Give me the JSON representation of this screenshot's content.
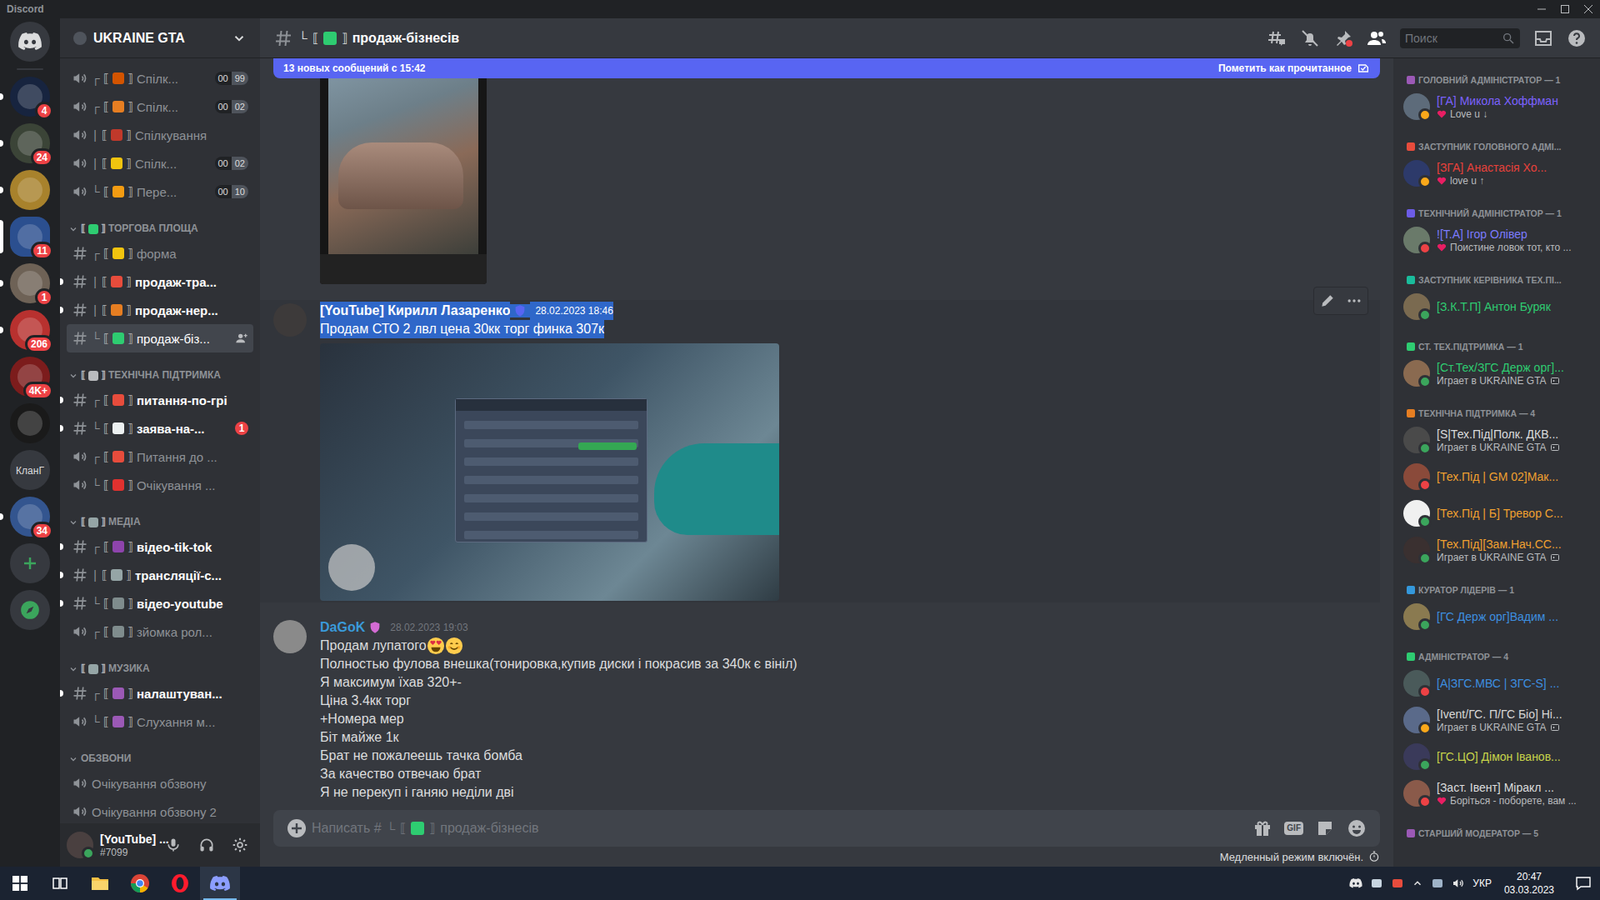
{
  "window": {
    "title": "Discord"
  },
  "servers": [
    {
      "kind": "home",
      "color": "#36393f",
      "badge": "",
      "unread": false,
      "selected": false
    },
    {
      "kind": "server",
      "color": "#17243f",
      "badge": "4",
      "unread": true,
      "selected": false
    },
    {
      "kind": "server",
      "color": "#3b4437",
      "badge": "24",
      "unread": true,
      "selected": false
    },
    {
      "kind": "server",
      "color": "#a8822c",
      "badge": "",
      "unread": true,
      "selected": false
    },
    {
      "kind": "server",
      "color": "#2b4f8f",
      "badge": "11",
      "unread": false,
      "selected": true
    },
    {
      "kind": "server",
      "color": "#6e6256",
      "badge": "1",
      "unread": true,
      "selected": false
    },
    {
      "kind": "server",
      "color": "#b8312f",
      "badge": "206",
      "unread": true,
      "selected": false
    },
    {
      "kind": "server",
      "color": "#7c1c1c",
      "badge": "4K+",
      "unread": false,
      "selected": false
    },
    {
      "kind": "server",
      "color": "#1a1a1a",
      "badge": "",
      "unread": false,
      "selected": false
    },
    {
      "kind": "text",
      "label": "КланГ",
      "color": "#36393f",
      "badge": "",
      "unread": false,
      "selected": false
    },
    {
      "kind": "server",
      "color": "#33558f",
      "badge": "34",
      "unread": true,
      "selected": false
    },
    {
      "kind": "add",
      "color": "#36393f",
      "badge": "",
      "unread": false,
      "selected": false
    },
    {
      "kind": "explore",
      "color": "#36393f",
      "badge": "",
      "unread": false,
      "selected": false
    }
  ],
  "sidebar": {
    "server_name": "UKRAINE GTA",
    "bracket_open": "⟦",
    "bracket_close": "⟧",
    "groups": [
      {
        "category": null,
        "channels": [
          {
            "kind": "voice",
            "tree": "┌",
            "emoji_color": "#d35400",
            "name": "Спілк...",
            "counts": [
              "00",
              "99"
            ],
            "unread": false,
            "selected": false,
            "badge": "",
            "invite": false
          },
          {
            "kind": "voice",
            "tree": "┌",
            "emoji_color": "#e67e22",
            "name": "Спілк...",
            "counts": [
              "00",
              "02"
            ],
            "unread": false,
            "selected": false,
            "badge": "",
            "invite": false
          },
          {
            "kind": "voice",
            "tree": "|",
            "emoji_color": "#c0392b",
            "name": "Спілкування",
            "counts": [],
            "unread": false,
            "selected": false,
            "badge": "",
            "invite": false
          },
          {
            "kind": "voice",
            "tree": "|",
            "emoji_color": "#f1c40f",
            "name": "Спілк...",
            "counts": [
              "00",
              "02"
            ],
            "unread": false,
            "selected": false,
            "badge": "",
            "invite": false
          },
          {
            "kind": "voice",
            "tree": "└",
            "emoji_color": "#f39c12",
            "name": "Пере...",
            "counts": [
              "00",
              "10"
            ],
            "unread": false,
            "selected": false,
            "badge": "",
            "invite": false
          }
        ]
      },
      {
        "category": {
          "label": "ТОРГОВА ПЛОЩА",
          "emoji_color": "#2ecc71",
          "expanded": true
        },
        "channels": [
          {
            "kind": "text",
            "tree": "┌",
            "emoji_color": "#f1c40f",
            "name": "форма",
            "counts": [],
            "unread": false,
            "selected": false,
            "badge": "",
            "invite": false
          },
          {
            "kind": "text",
            "tree": "|",
            "emoji_color": "#e74c3c",
            "name": "продаж-тра...",
            "counts": [],
            "unread": true,
            "selected": false,
            "badge": "",
            "invite": false
          },
          {
            "kind": "text",
            "tree": "|",
            "emoji_color": "#e67e22",
            "name": "продаж-нер...",
            "counts": [],
            "unread": true,
            "selected": false,
            "badge": "",
            "invite": false
          },
          {
            "kind": "text",
            "tree": "└",
            "emoji_color": "#2ecc71",
            "name": "продаж-біз...",
            "counts": [],
            "unread": false,
            "selected": true,
            "badge": "",
            "invite": true
          }
        ]
      },
      {
        "category": {
          "label": "ТЕХНІЧНА ПІДТРИМКА",
          "emoji_color": "#b9bbbe",
          "expanded": true
        },
        "channels": [
          {
            "kind": "text",
            "tree": "┌",
            "emoji_color": "#e74c3c",
            "name": "питання-по-грі",
            "counts": [],
            "unread": true,
            "selected": false,
            "badge": "",
            "invite": false
          },
          {
            "kind": "text",
            "tree": "└",
            "emoji_color": "#ecf0f1",
            "name": "заява-на-...",
            "counts": [],
            "unread": true,
            "selected": false,
            "badge": "1",
            "invite": false
          },
          {
            "kind": "voice",
            "tree": "┌",
            "emoji_color": "#e74c3c",
            "name": "Питання до ...",
            "counts": [],
            "unread": false,
            "selected": false,
            "badge": "",
            "invite": false
          },
          {
            "kind": "voice",
            "tree": "└",
            "emoji_color": "#e0312f",
            "name": "Очікування ...",
            "counts": [],
            "unread": false,
            "selected": false,
            "badge": "",
            "invite": false
          }
        ]
      },
      {
        "category": {
          "label": "МЕДІА",
          "emoji_color": "#95a5a6",
          "expanded": true
        },
        "channels": [
          {
            "kind": "text",
            "tree": "┌",
            "emoji_color": "#8e44ad",
            "name": "відео-tik-tok",
            "counts": [],
            "unread": true,
            "selected": false,
            "badge": "",
            "invite": false
          },
          {
            "kind": "text",
            "tree": "|",
            "emoji_color": "#95a5a6",
            "name": "трансляції-с...",
            "counts": [],
            "unread": true,
            "selected": false,
            "badge": "",
            "invite": false
          },
          {
            "kind": "text",
            "tree": "└",
            "emoji_color": "#7f8c8d",
            "name": "відео-youtube",
            "counts": [],
            "unread": true,
            "selected": false,
            "badge": "",
            "invite": false
          },
          {
            "kind": "voice",
            "tree": "┌",
            "emoji_color": "#7f8c8d",
            "name": "зйомка рол...",
            "counts": [],
            "unread": false,
            "selected": false,
            "badge": "",
            "invite": false
          }
        ]
      },
      {
        "category": {
          "label": "МУЗИКА",
          "emoji_color": "#95a5a6",
          "expanded": true
        },
        "channels": [
          {
            "kind": "text",
            "tree": "┌",
            "emoji_color": "#9b59b6",
            "name": "налаштуван...",
            "counts": [],
            "unread": true,
            "selected": false,
            "badge": "",
            "invite": false
          },
          {
            "kind": "voice",
            "tree": "└",
            "emoji_color": "#9b59b6",
            "name": "Слухання м...",
            "counts": [],
            "unread": false,
            "selected": false,
            "badge": "",
            "invite": false
          }
        ]
      },
      {
        "category": {
          "label": "ОБЗВОНИ",
          "emoji_color": null,
          "expanded": true
        },
        "channels": [
          {
            "kind": "voice",
            "tree": "",
            "emoji_color": null,
            "name": "Очікування обзвону",
            "counts": [],
            "unread": false,
            "selected": false,
            "badge": "",
            "invite": false
          },
          {
            "kind": "voice",
            "tree": "",
            "emoji_color": null,
            "name": "Очікування обзвону 2",
            "counts": [],
            "unread": false,
            "selected": false,
            "badge": "",
            "invite": false
          }
        ]
      }
    ]
  },
  "user": {
    "name": "[YouTube] ...",
    "tag": "#7099",
    "status_color": "#3ba55c",
    "avatar_color": "#4a4040"
  },
  "chat": {
    "channel": {
      "tree": "└",
      "emoji_color": "#2ecc71",
      "name": "продаж-бізнесів"
    },
    "search_placeholder": "Поиск",
    "new_messages": {
      "text": "13 новых сообщений с 15:42",
      "action": "Пометить как прочитанное"
    },
    "messages": [
      {
        "kind": "continuation",
        "image": {
          "kind": "photo"
        }
      },
      {
        "kind": "message",
        "author": "[YouTube] Кирилл Лазаренко",
        "author_color": "#ffffff",
        "avatar_color": "#3d3a3a",
        "badge_color": "#5865f2",
        "timestamp": "28.02.2023 18:46",
        "highlighted": true,
        "hovered": true,
        "lines": [
          {
            "text": "Продам СТО 2 лвл цена 30кк торг финка 307к",
            "emoji": []
          }
        ],
        "image": {
          "kind": "game"
        }
      },
      {
        "kind": "message",
        "author": "DaGoK",
        "author_color": "#3a9ad9",
        "avatar_color": "#8a8a8a",
        "badge_color": "#d46bd4",
        "timestamp": "28.02.2023 19:03",
        "highlighted": false,
        "hovered": false,
        "lines": [
          {
            "text": "Продам лупатого",
            "emoji": [
              "heart-eyes",
              "smile"
            ]
          },
          {
            "text": "Полностью фулова внешка(тонировка,купив диски і покрасив за 340к є вініл)",
            "emoji": []
          },
          {
            "text": "Я максимум їхав 320+-",
            "emoji": []
          },
          {
            "text": "Ціна 3.4кк торг",
            "emoji": []
          },
          {
            "text": "+Номера мер",
            "emoji": []
          },
          {
            "text": "Біт майже 1к",
            "emoji": []
          },
          {
            "text": "Брат не пожалеешь тачка бомба",
            "emoji": []
          },
          {
            "text": "За качество отвечаю брат",
            "emoji": []
          },
          {
            "text": "Я не перекуп і ганяю неділи дві",
            "emoji": []
          }
        ],
        "image": null
      }
    ],
    "input": {
      "prefix": "Написать #",
      "gif_label": "GIF"
    },
    "slowmode": "Медленный режим включён."
  },
  "members": [
    {
      "label": "ГОЛОВНИЙ АДМІНІСТРАТОР — 1",
      "icon_color": "#9b59b6",
      "members": [
        {
          "name": "[ГА] Микола Хоффман",
          "color": "#7b61ff",
          "status_color": "#faa81a",
          "activity": "Love u ↓",
          "activity_kind": "custom",
          "avatar_color": "#5d6b7a"
        }
      ]
    },
    {
      "label": "ЗАСТУПНИК ГОЛОВНОГО АДМІ...",
      "icon_color": "#e74c3c",
      "members": [
        {
          "name": "[ЗГА] Анастасія Хо...",
          "color": "#e8413b",
          "status_color": "#faa81a",
          "activity": "love u ↑",
          "activity_kind": "custom",
          "avatar_color": "#2d3a6a"
        }
      ]
    },
    {
      "label": "ТЕХНІЧНИЙ АДМІНІСТРАТОР — 1",
      "icon_color": "#6c5ce7",
      "members": [
        {
          "name": "![Т.А] Ігор Олівер",
          "color": "#7b7bff",
          "status_color": "#ed4245",
          "activity": "Поистине ловок тот, кто ...",
          "activity_kind": "custom",
          "avatar_color": "#6a7a6a"
        }
      ]
    },
    {
      "label": "ЗАСТУПНИК КЕРІВНИКА ТЕХ.ПІ...",
      "icon_color": "#1abc9c",
      "members": [
        {
          "name": "[З.К.Т.П] Антон Буряк",
          "color": "#2ecc71",
          "status_color": "#3ba55c",
          "activity": "",
          "activity_kind": "none",
          "avatar_color": "#7a6a50"
        }
      ]
    },
    {
      "label": "СТ. ТЕХ.ПІДТРИМКА — 1",
      "icon_color": "#2ecc71",
      "members": [
        {
          "name": "[Ст.Тех/ЗГС Держ орг]...",
          "color": "#2ecc71",
          "status_color": "#3ba55c",
          "activity": "Играет в UKRAINE GTA",
          "activity_kind": "game",
          "avatar_color": "#8a6a50"
        }
      ]
    },
    {
      "label": "ТЕХНІЧНА ПІДТРИМКА — 4",
      "icon_color": "#e67e22",
      "members": [
        {
          "name": "[S|Тех.Під|Полк. ДКВ...",
          "color": "#dcddde",
          "status_color": "#3ba55c",
          "activity": "Играет в UKRAINE GTA",
          "activity_kind": "game",
          "avatar_color": "#4a4a4a"
        },
        {
          "name": "[Тех.Під | GM 02]Мак...",
          "color": "#f0a030",
          "status_color": "#ed4245",
          "activity": "",
          "activity_kind": "none",
          "avatar_color": "#8a4a3a"
        },
        {
          "name": "[Тех.Під | Б] Тревор С...",
          "color": "#f0a030",
          "status_color": "#3ba55c",
          "activity": "",
          "activity_kind": "none",
          "avatar_color": "#f0f0f0"
        },
        {
          "name": "[Тех.Під][Зам.Нач.СС...",
          "color": "#f0a030",
          "status_color": "#3ba55c",
          "activity": "Играет в UKRAINE GTA",
          "activity_kind": "game",
          "avatar_color": "#3a3030"
        }
      ]
    },
    {
      "label": "КУРАТОР ЛІДЕРІВ — 1",
      "icon_color": "#3498db",
      "members": [
        {
          "name": "[ГС Держ орг]Вадим ...",
          "color": "#3d8fe0",
          "status_color": "#3ba55c",
          "activity": "",
          "activity_kind": "none",
          "avatar_color": "#8a7a50"
        }
      ]
    },
    {
      "label": "АДМІНІСТРАТОР — 4",
      "icon_color": "#2ecc71",
      "members": [
        {
          "name": "[А|ЗГС.МВС | ЗГС-S] ...",
          "color": "#3d8fe0",
          "status_color": "#ed4245",
          "activity": "",
          "activity_kind": "none",
          "avatar_color": "#4a5a5a"
        },
        {
          "name": "[Ivent/ГС. П/ГС Біо] Ні...",
          "color": "#d8d8d8",
          "status_color": "#faa81a",
          "activity": "Играет в UKRAINE GTA",
          "activity_kind": "game",
          "avatar_color": "#5a6a8a"
        },
        {
          "name": "[ГС.ЦО] Дімон Іванов...",
          "color": "#c8d44a",
          "status_color": "#3ba55c",
          "activity": "",
          "activity_kind": "none",
          "avatar_color": "#3a3a5a"
        },
        {
          "name": "[Заст. Івент] Міракл ...",
          "color": "#dcddde",
          "status_color": "#ed4245",
          "activity": "Боріться - поборете, вам ...",
          "activity_kind": "custom",
          "avatar_color": "#8a5a4a"
        }
      ]
    },
    {
      "label": "СТАРШИЙ МОДЕРАТОР — 5",
      "icon_color": "#9b59b6",
      "members": []
    }
  ],
  "taskbar": {
    "apps": [
      {
        "kind": "start",
        "selected": false
      },
      {
        "kind": "task-view",
        "selected": false
      },
      {
        "kind": "explorer",
        "selected": false
      },
      {
        "kind": "chrome",
        "selected": false
      },
      {
        "kind": "opera",
        "selected": false
      },
      {
        "kind": "discord",
        "selected": true
      }
    ],
    "tray": {
      "language": "УКР",
      "time": "20:47",
      "date": "03.03.2023"
    }
  }
}
